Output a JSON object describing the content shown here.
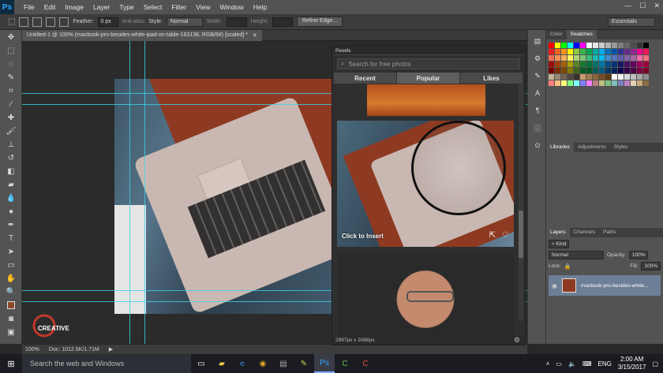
{
  "app": {
    "logo": "Ps"
  },
  "menu": [
    "File",
    "Edit",
    "Image",
    "Layer",
    "Type",
    "Select",
    "Filter",
    "View",
    "Window",
    "Help"
  ],
  "options": {
    "feather_label": "Feather:",
    "feather_value": "0 px",
    "antialias_label": "Anti-alias",
    "style_label": "Style:",
    "style_value": "Normal",
    "width_label": "Width:",
    "height_label": "Height:",
    "refine_edge": "Refine Edge...",
    "workspace": "Essentials"
  },
  "document": {
    "tab_title": "Untitled-1 @ 100% (macbook-pro-besides-white-ipad-on-table-163138, RGB/8#) [scaled] *",
    "zoom": "100%",
    "doc_info": "Doc: 1012.5K/1.71M"
  },
  "pexels": {
    "panel_title": "Pexels",
    "search_placeholder": "Search for free photos",
    "tabs": [
      "Recent",
      "Popular",
      "Likes"
    ],
    "active_tab": "Popular",
    "click_insert": "Click to Insert",
    "dimensions": "2897px x 2068px"
  },
  "right_panels": {
    "color_tabs": [
      "Color",
      "Swatches"
    ],
    "active_color_tab": "Swatches",
    "lib_tabs": [
      "Libraries",
      "Adjustments",
      "Styles"
    ],
    "active_lib_tab": "Libraries",
    "layers_tabs": [
      "Layers",
      "Channels",
      "Paths"
    ],
    "active_layers_tab": "Layers",
    "kind_label": "Kind",
    "blend_mode": "Normal",
    "opacity_label": "Opacity:",
    "opacity_value": "100%",
    "lock_label": "Lock:",
    "fill_label": "Fill:",
    "fill_value": "100%",
    "layer_name": "macbook-pro-besides-white..."
  },
  "watermark": {
    "text": "CREATIVE"
  },
  "taskbar": {
    "search_placeholder": "Search the web and Windows",
    "lang": "ENG",
    "time": "2:00 AM",
    "date": "3/15/2017"
  }
}
